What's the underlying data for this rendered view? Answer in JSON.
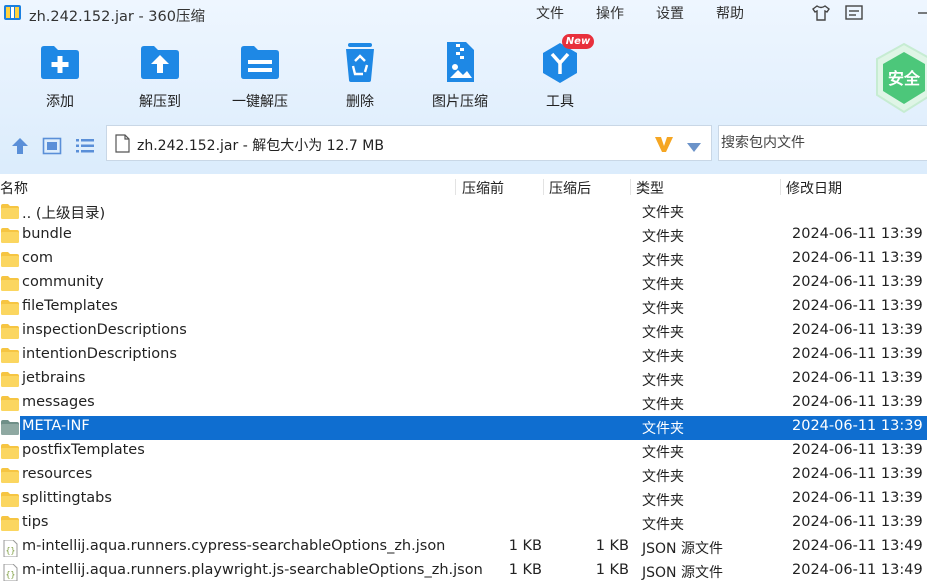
{
  "window": {
    "title": "zh.242.152.jar - 360压缩",
    "menu": [
      "文件",
      "操作",
      "设置",
      "帮助"
    ]
  },
  "toolbar": {
    "buttons": [
      {
        "label": "添加",
        "icon": "add-folder-icon"
      },
      {
        "label": "解压到",
        "icon": "extract-to-icon"
      },
      {
        "label": "一键解压",
        "icon": "one-click-extract-icon"
      },
      {
        "label": "删除",
        "icon": "recycle-bin-icon"
      },
      {
        "label": "图片压缩",
        "icon": "image-compress-icon"
      },
      {
        "label": "工具",
        "icon": "tools-icon"
      }
    ],
    "new_badge": "New",
    "safe_badge": "安全"
  },
  "navbar": {
    "address": "zh.242.152.jar - 解包大小为 12.7 MB",
    "search_placeholder": "搜索包内文件"
  },
  "columns": {
    "name": "名称",
    "before": "压缩前",
    "after": "压缩后",
    "type": "类型",
    "date": "修改日期"
  },
  "rows": [
    {
      "name": ".. (上级目录)",
      "before": "",
      "after": "",
      "type": "文件夹",
      "date": "",
      "icon": "folder"
    },
    {
      "name": "bundle",
      "before": "",
      "after": "",
      "type": "文件夹",
      "date": "2024-06-11 13:39",
      "icon": "folder"
    },
    {
      "name": "com",
      "before": "",
      "after": "",
      "type": "文件夹",
      "date": "2024-06-11 13:39",
      "icon": "folder"
    },
    {
      "name": "community",
      "before": "",
      "after": "",
      "type": "文件夹",
      "date": "2024-06-11 13:39",
      "icon": "folder"
    },
    {
      "name": "fileTemplates",
      "before": "",
      "after": "",
      "type": "文件夹",
      "date": "2024-06-11 13:39",
      "icon": "folder"
    },
    {
      "name": "inspectionDescriptions",
      "before": "",
      "after": "",
      "type": "文件夹",
      "date": "2024-06-11 13:39",
      "icon": "folder"
    },
    {
      "name": "intentionDescriptions",
      "before": "",
      "after": "",
      "type": "文件夹",
      "date": "2024-06-11 13:39",
      "icon": "folder"
    },
    {
      "name": "jetbrains",
      "before": "",
      "after": "",
      "type": "文件夹",
      "date": "2024-06-11 13:39",
      "icon": "folder"
    },
    {
      "name": "messages",
      "before": "",
      "after": "",
      "type": "文件夹",
      "date": "2024-06-11 13:39",
      "icon": "folder"
    },
    {
      "name": "META-INF",
      "before": "",
      "after": "",
      "type": "文件夹",
      "date": "2024-06-11 13:39",
      "icon": "folder-gray",
      "selected": true
    },
    {
      "name": "postfixTemplates",
      "before": "",
      "after": "",
      "type": "文件夹",
      "date": "2024-06-11 13:39",
      "icon": "folder"
    },
    {
      "name": "resources",
      "before": "",
      "after": "",
      "type": "文件夹",
      "date": "2024-06-11 13:39",
      "icon": "folder"
    },
    {
      "name": "splittingtabs",
      "before": "",
      "after": "",
      "type": "文件夹",
      "date": "2024-06-11 13:39",
      "icon": "folder"
    },
    {
      "name": "tips",
      "before": "",
      "after": "",
      "type": "文件夹",
      "date": "2024-06-11 13:39",
      "icon": "folder"
    },
    {
      "name": "m-intellij.aqua.runners.cypress-searchableOptions_zh.json",
      "before": "1 KB",
      "after": "1 KB",
      "type": "JSON 源文件",
      "date": "2024-06-11 13:49",
      "icon": "json-file"
    },
    {
      "name": "m-intellij.aqua.runners.playwright.js-searchableOptions_zh.json",
      "before": "1 KB",
      "after": "1 KB",
      "type": "JSON 源文件",
      "date": "2024-06-11 13:49",
      "icon": "json-file"
    }
  ],
  "colors": {
    "accent": "#0f6ed0",
    "folder": "#f6c542",
    "folder_meta": "#7f9b94",
    "toolbar_bg": "#e3f0fd",
    "icon_blue": "#1e88e5"
  }
}
